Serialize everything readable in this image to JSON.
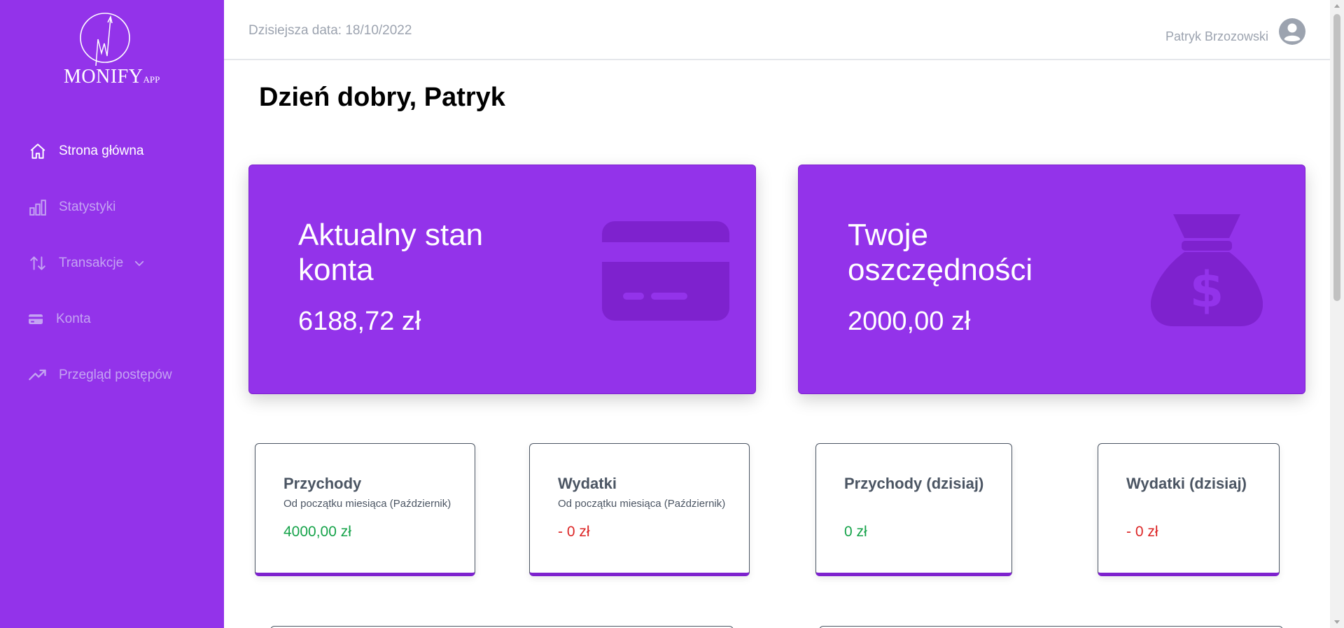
{
  "app": {
    "logo_main": "MONIFY",
    "logo_suffix": "APP"
  },
  "sidebar": {
    "items": [
      {
        "label": "Strona główna",
        "icon": "home-icon",
        "active": true
      },
      {
        "label": "Statystyki",
        "icon": "bar-chart-icon",
        "active": false
      },
      {
        "label": "Transakcje",
        "icon": "arrows-up-down-icon",
        "active": false
      },
      {
        "label": "Konta",
        "icon": "credit-card-icon",
        "active": false
      },
      {
        "label": "Przegląd postępów",
        "icon": "trending-up-icon",
        "active": false
      }
    ]
  },
  "header": {
    "date_label": "Dzisiejsza data: 18/10/2022",
    "user_name": "Patryk Brzozowski",
    "user_icon": "user-avatar-icon"
  },
  "main": {
    "greeting": "Dzień dobry, Patryk",
    "balance_card": {
      "title": "Aktualny stan konta",
      "amount": "6188,72 zł",
      "icon": "credit-card-icon"
    },
    "savings_card": {
      "title": "Twoje oszczędności",
      "amount": "2000,00 zł",
      "icon": "money-bag-icon"
    },
    "stats": [
      {
        "title": "Przychody",
        "subtitle": "Od początku miesiąca (Październik)",
        "value": "4000,00 zł",
        "tone": "positive"
      },
      {
        "title": "Wydatki",
        "subtitle": "Od początku miesiąca (Październik)",
        "value": "- 0 zł",
        "tone": "negative"
      },
      {
        "title": "Przychody (dzisiaj)",
        "subtitle": "",
        "value": "0 zł",
        "tone": "positive"
      },
      {
        "title": "Wydatki (dzisiaj)",
        "subtitle": "",
        "value": "- 0 zł",
        "tone": "negative"
      }
    ]
  },
  "colors": {
    "accent": "#9333ea",
    "accent_dark": "#7e22ce",
    "positive": "#16a34a",
    "negative": "#dc2626",
    "muted_text": "#9ca3af"
  }
}
